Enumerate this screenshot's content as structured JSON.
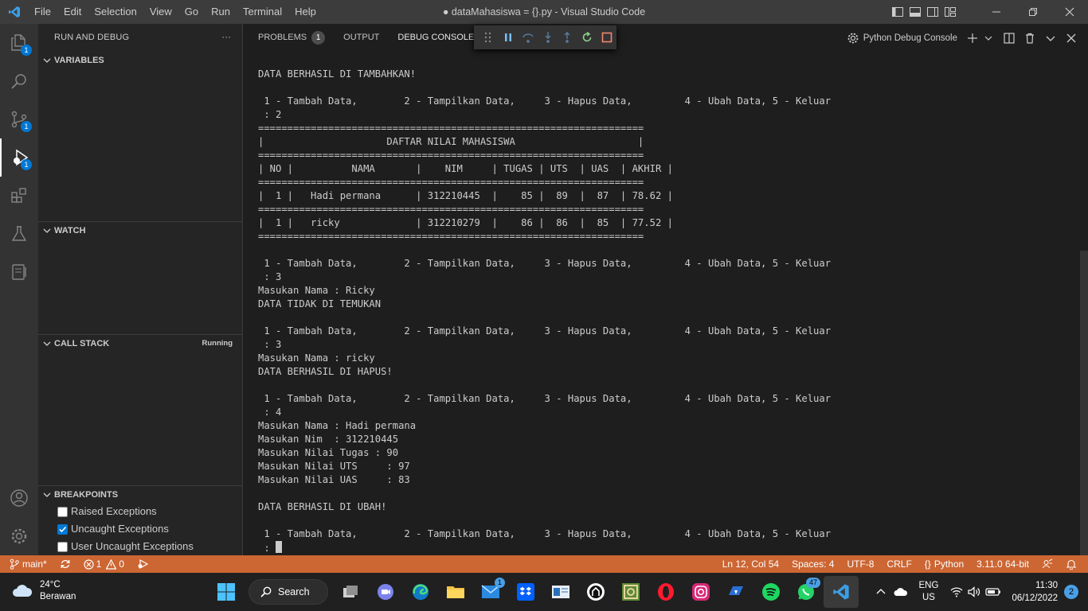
{
  "titlebar": {
    "menu": [
      "File",
      "Edit",
      "Selection",
      "View",
      "Go",
      "Run",
      "Terminal",
      "Help"
    ],
    "title": "● dataMahasiswa = {}.py - Visual Studio Code"
  },
  "activity": {
    "explorer_badge": "1",
    "scm_badge": "1",
    "debug_badge": "1"
  },
  "sidebar": {
    "header": "RUN AND DEBUG",
    "more": "···",
    "variables": "VARIABLES",
    "watch": "WATCH",
    "call_stack": "CALL STACK",
    "call_stack_status": "Running",
    "breakpoints": "BREAKPOINTS",
    "breakpoint_items": [
      {
        "label": "Raised Exceptions",
        "checked": false
      },
      {
        "label": "Uncaught Exceptions",
        "checked": true
      },
      {
        "label": "User Uncaught Exceptions",
        "checked": false
      }
    ]
  },
  "panel": {
    "tabs": {
      "problems": "PROBLEMS",
      "problems_count": "1",
      "output": "OUTPUT",
      "debug_console": "DEBUG CONSOLE"
    },
    "terminal_name": "Python Debug Console"
  },
  "console_lines": [
    "DATA BERHASIL DI TAMBAHKAN!",
    "",
    " 1 - Tambah Data,        2 - Tampilkan Data,     3 - Hapus Data,         4 - Ubah Data, 5 - Keluar",
    " : 2",
    "==================================================================",
    "|                     DAFTAR NILAI MAHASISWA                     |",
    "==================================================================",
    "| NO |          NAMA       |    NIM     | TUGAS | UTS  | UAS  | AKHIR |",
    "==================================================================",
    "|  1 |   Hadi permana      | 312210445  |    85 |  89  |  87  | 78.62 |",
    "==================================================================",
    "|  1 |   ricky             | 312210279  |    86 |  86  |  85  | 77.52 |",
    "==================================================================",
    "",
    " 1 - Tambah Data,        2 - Tampilkan Data,     3 - Hapus Data,         4 - Ubah Data, 5 - Keluar",
    " : 3",
    "Masukan Nama : Ricky",
    "DATA TIDAK DI TEMUKAN",
    "",
    " 1 - Tambah Data,        2 - Tampilkan Data,     3 - Hapus Data,         4 - Ubah Data, 5 - Keluar",
    " : 3",
    "Masukan Nama : ricky",
    "DATA BERHASIL DI HAPUS!",
    "",
    " 1 - Tambah Data,        2 - Tampilkan Data,     3 - Hapus Data,         4 - Ubah Data, 5 - Keluar",
    " : 4",
    "Masukan Nama : Hadi permana",
    "Masukan Nim  : 312210445",
    "Masukan Nilai Tugas : 90",
    "Masukan Nilai UTS     : 97",
    "Masukan Nilai UAS     : 83",
    "",
    "DATA BERHASIL DI UBAH!",
    "",
    " 1 - Tambah Data,        2 - Tampilkan Data,     3 - Hapus Data,         4 - Ubah Data, 5 - Keluar",
    " : "
  ],
  "statusbar": {
    "branch": "main*",
    "errors": "1",
    "warnings": "0",
    "position": "Ln 12, Col 54",
    "spaces": "Spaces: 4",
    "encoding": "UTF-8",
    "eol": "CRLF",
    "language": "Python",
    "interpreter": "3.11.0 64-bit"
  },
  "taskbar": {
    "temp": "24°C",
    "weather": "Berawan",
    "search": "Search",
    "mail_badge": "1",
    "whatsapp_badge": "47",
    "lang": "ENG",
    "region": "US",
    "time": "11:30",
    "date": "06/12/2022",
    "notifications": "2"
  },
  "colors": {
    "statusbar": "#cc6633",
    "accent": "#0078d4"
  }
}
